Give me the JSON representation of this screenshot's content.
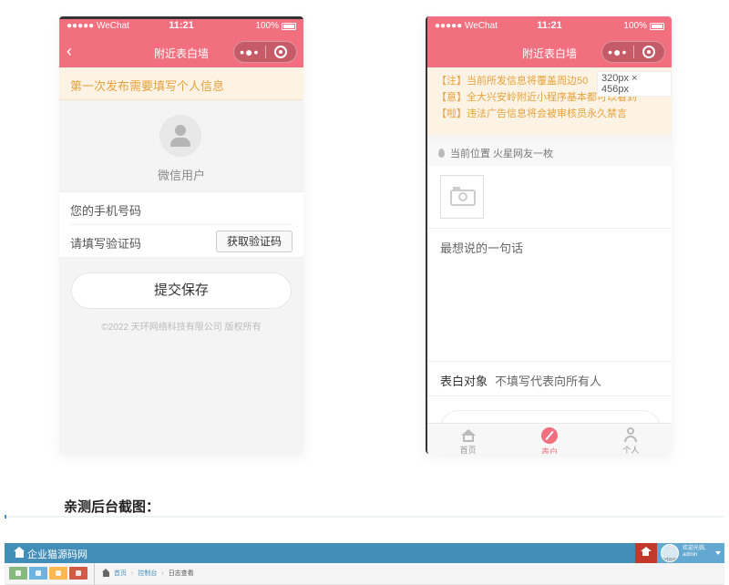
{
  "phone1": {
    "status": {
      "carrier": "●●●●● WeChat",
      "time": "11:21",
      "battery": "100%"
    },
    "nav": {
      "back": "‹",
      "title": "附近表白墙",
      "menu": "•●•"
    },
    "notice": "第一次发布需要填写个人信息",
    "username": "微信用户",
    "phone_placeholder": "您的手机号码",
    "code_placeholder": "请填写验证码",
    "get_code_label": "获取验证码",
    "submit_label": "提交保存",
    "copyright": "©2022 天环网络科技有限公司 版权所有"
  },
  "phone2": {
    "status": {
      "carrier": "●●●●● WeChat",
      "time": "11:21",
      "battery": "100%"
    },
    "nav": {
      "title": "附近表白墙",
      "menu": "•●•"
    },
    "notices": [
      "【注】当前所发信息将覆盖周边50",
      "【意】全大兴安岭附近小程序基本都可以看到",
      "【啦】违法广告信息将会被审核员永久禁言"
    ],
    "size_tag": "320px × 456px",
    "location": "当前位置  火星网友一枚",
    "phrase_label": "最想说的一句话",
    "target_label": "表白对象",
    "target_hint": "不填写代表向所有人",
    "tabs": [
      {
        "label": "首页",
        "icon": "home-icon"
      },
      {
        "label": "表白",
        "icon": "pen-icon"
      },
      {
        "label": "个人",
        "icon": "person-icon"
      }
    ]
  },
  "caption": "亲测后台截图：",
  "admin": {
    "brand": "企业猫源码网",
    "welcome_line1": "欢迎光临,",
    "welcome_line2": "admin",
    "avatar_text": "admin",
    "breadcrumb": {
      "home": "首页",
      "console": "控制台",
      "current": "日志查看"
    }
  },
  "colors": {
    "accent": "#f26f7f",
    "notice": "#e6a23c",
    "admin_blue": "#438eb9"
  }
}
